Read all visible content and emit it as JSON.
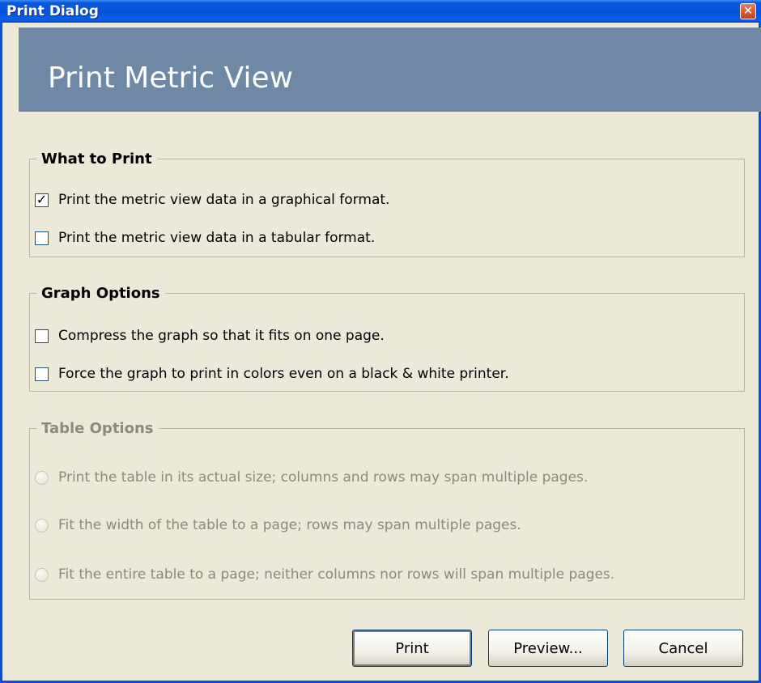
{
  "window": {
    "title": "Print Dialog",
    "close_glyph": "✕"
  },
  "header": {
    "title": "Print Metric View"
  },
  "what_to_print": {
    "legend": "What to Print",
    "options": [
      {
        "label": "Print the metric view data in a graphical format.",
        "checked": true
      },
      {
        "label": "Print the metric view data in a tabular format.",
        "checked": false
      }
    ]
  },
  "graph_options": {
    "legend": "Graph Options",
    "options": [
      {
        "label": "Compress the graph so that it fits on one page.",
        "checked": false
      },
      {
        "label": "Force the graph to print in colors even on a black & white printer.",
        "checked": false
      }
    ]
  },
  "table_options": {
    "legend": "Table Options",
    "enabled": false,
    "options": [
      {
        "label": "Print the table in its actual size; columns and rows may span multiple pages.",
        "selected": false
      },
      {
        "label": "Fit the width of the table to a page; rows may span multiple pages.",
        "selected": false
      },
      {
        "label": "Fit the entire table to a page; neither columns nor rows will span multiple pages.",
        "selected": false
      }
    ]
  },
  "buttons": {
    "print": "Print",
    "preview": "Preview...",
    "cancel": "Cancel"
  },
  "colors": {
    "titlebar": "#0a4fd4",
    "header_band": "#6e88a5",
    "dialog_bg": "#ece9d8"
  }
}
